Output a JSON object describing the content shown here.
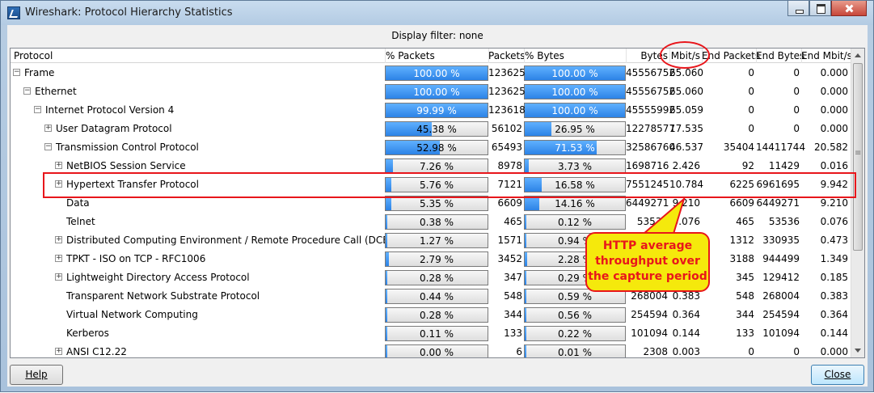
{
  "window": {
    "title": "Wireshark: Protocol Hierarchy Statistics"
  },
  "display_filter": "Display filter: none",
  "columns": [
    "Protocol",
    "% Packets",
    "Packets",
    "% Bytes",
    "Bytes",
    "Mbit/s",
    "End Packets",
    "End Bytes",
    "End Mbit/s"
  ],
  "rows": [
    {
      "indent": 0,
      "expander": "minus",
      "protocol": "Frame",
      "pct_packets": "100.00 %",
      "pct_packets_value": 100.0,
      "packets": "123625",
      "pct_bytes": "100.00 %",
      "pct_bytes_value": 100.0,
      "bytes": "45556752",
      "mbits": "65.060",
      "end_packets": "0",
      "end_bytes": "0",
      "end_mbits": "0.000"
    },
    {
      "indent": 1,
      "expander": "minus",
      "protocol": "Ethernet",
      "pct_packets": "100.00 %",
      "pct_packets_value": 100.0,
      "packets": "123625",
      "pct_bytes": "100.00 %",
      "pct_bytes_value": 100.0,
      "bytes": "45556752",
      "mbits": "65.060",
      "end_packets": "0",
      "end_bytes": "0",
      "end_mbits": "0.000"
    },
    {
      "indent": 2,
      "expander": "minus",
      "protocol": "Internet Protocol Version 4",
      "pct_packets": "99.99 %",
      "pct_packets_value": 99.99,
      "packets": "123618",
      "pct_bytes": "100.00 %",
      "pct_bytes_value": 100.0,
      "bytes": "45555992",
      "mbits": "65.059",
      "end_packets": "0",
      "end_bytes": "0",
      "end_mbits": "0.000"
    },
    {
      "indent": 3,
      "expander": "plus",
      "protocol": "User Datagram Protocol",
      "pct_packets": "45.38 %",
      "pct_packets_value": 45.38,
      "packets": "56102",
      "pct_bytes": "26.95 %",
      "pct_bytes_value": 26.95,
      "bytes": "12278577",
      "mbits": "17.535",
      "end_packets": "0",
      "end_bytes": "0",
      "end_mbits": "0.000"
    },
    {
      "indent": 3,
      "expander": "minus",
      "protocol": "Transmission Control Protocol",
      "pct_packets": "52.98 %",
      "pct_packets_value": 52.98,
      "packets": "65493",
      "pct_bytes": "71.53 %",
      "pct_bytes_value": 71.53,
      "bytes": "32586760",
      "mbits": "46.537",
      "end_packets": "35404",
      "end_bytes": "14411744",
      "end_mbits": "20.582"
    },
    {
      "indent": 4,
      "expander": "plus",
      "protocol": "NetBIOS Session Service",
      "pct_packets": "7.26 %",
      "pct_packets_value": 7.26,
      "packets": "8978",
      "pct_bytes": "3.73 %",
      "pct_bytes_value": 3.73,
      "bytes": "1698716",
      "mbits": "2.426",
      "end_packets": "92",
      "end_bytes": "11429",
      "end_mbits": "0.016"
    },
    {
      "indent": 4,
      "expander": "plus",
      "protocol": "Hypertext Transfer Protocol",
      "pct_packets": "5.76 %",
      "pct_packets_value": 5.76,
      "packets": "7121",
      "pct_bytes": "16.58 %",
      "pct_bytes_value": 16.58,
      "bytes": "7551245",
      "mbits": "10.784",
      "end_packets": "6225",
      "end_bytes": "6961695",
      "end_mbits": "9.942"
    },
    {
      "indent": 4,
      "expander": "",
      "protocol": "Data",
      "pct_packets": "5.35 %",
      "pct_packets_value": 5.35,
      "packets": "6609",
      "pct_bytes": "14.16 %",
      "pct_bytes_value": 14.16,
      "bytes": "6449271",
      "mbits": "9.210",
      "end_packets": "6609",
      "end_bytes": "6449271",
      "end_mbits": "9.210"
    },
    {
      "indent": 4,
      "expander": "",
      "protocol": "Telnet",
      "pct_packets": "0.38 %",
      "pct_packets_value": 0.38,
      "packets": "465",
      "pct_bytes": "0.12 %",
      "pct_bytes_value": 0.12,
      "bytes": "53536",
      "mbits": "0.076",
      "end_packets": "465",
      "end_bytes": "53536",
      "end_mbits": "0.076"
    },
    {
      "indent": 4,
      "expander": "plus",
      "protocol": "Distributed Computing Environment / Remote Procedure Call (DCE/RPC)",
      "pct_packets": "1.27 %",
      "pct_packets_value": 1.27,
      "packets": "1571",
      "pct_bytes": "0.94 %",
      "pct_bytes_value": 0.94,
      "bytes": "",
      "mbits": "",
      "end_packets": "1312",
      "end_bytes": "330935",
      "end_mbits": "0.473"
    },
    {
      "indent": 4,
      "expander": "plus",
      "protocol": "TPKT - ISO on TCP - RFC1006",
      "pct_packets": "2.79 %",
      "pct_packets_value": 2.79,
      "packets": "3452",
      "pct_bytes": "2.28 %",
      "pct_bytes_value": 2.28,
      "bytes": "",
      "mbits": "",
      "end_packets": "3188",
      "end_bytes": "944499",
      "end_mbits": "1.349"
    },
    {
      "indent": 4,
      "expander": "plus",
      "protocol": "Lightweight Directory Access Protocol",
      "pct_packets": "0.28 %",
      "pct_packets_value": 0.28,
      "packets": "347",
      "pct_bytes": "0.29 %",
      "pct_bytes_value": 0.29,
      "bytes": "",
      "mbits": "",
      "end_packets": "345",
      "end_bytes": "129412",
      "end_mbits": "0.185"
    },
    {
      "indent": 4,
      "expander": "",
      "protocol": "Transparent Network Substrate Protocol",
      "pct_packets": "0.44 %",
      "pct_packets_value": 0.44,
      "packets": "548",
      "pct_bytes": "0.59 %",
      "pct_bytes_value": 0.59,
      "bytes": "268004",
      "mbits": "0.383",
      "end_packets": "548",
      "end_bytes": "268004",
      "end_mbits": "0.383"
    },
    {
      "indent": 4,
      "expander": "",
      "protocol": "Virtual Network Computing",
      "pct_packets": "0.28 %",
      "pct_packets_value": 0.28,
      "packets": "344",
      "pct_bytes": "0.56 %",
      "pct_bytes_value": 0.56,
      "bytes": "254594",
      "mbits": "0.364",
      "end_packets": "344",
      "end_bytes": "254594",
      "end_mbits": "0.364"
    },
    {
      "indent": 4,
      "expander": "",
      "protocol": "Kerberos",
      "pct_packets": "0.11 %",
      "pct_packets_value": 0.11,
      "packets": "133",
      "pct_bytes": "0.22 %",
      "pct_bytes_value": 0.22,
      "bytes": "101094",
      "mbits": "0.144",
      "end_packets": "133",
      "end_bytes": "101094",
      "end_mbits": "0.144"
    },
    {
      "indent": 4,
      "expander": "plus",
      "protocol": "ANSI C12.22",
      "pct_packets": "0.00 %",
      "pct_packets_value": 0.0,
      "packets": "6",
      "pct_bytes": "0.01 %",
      "pct_bytes_value": 0.01,
      "bytes": "2308",
      "mbits": "0.003",
      "end_packets": "0",
      "end_bytes": "0",
      "end_mbits": "0.000"
    }
  ],
  "buttons": {
    "help": "Help",
    "close": "Close"
  },
  "annotation": {
    "callout_text": "HTTP average throughput over the capture period"
  },
  "colors": {
    "bar_fill": "#2c83e6",
    "highlight_red": "#e8161b",
    "callout_yellow": "#f5e90c"
  }
}
